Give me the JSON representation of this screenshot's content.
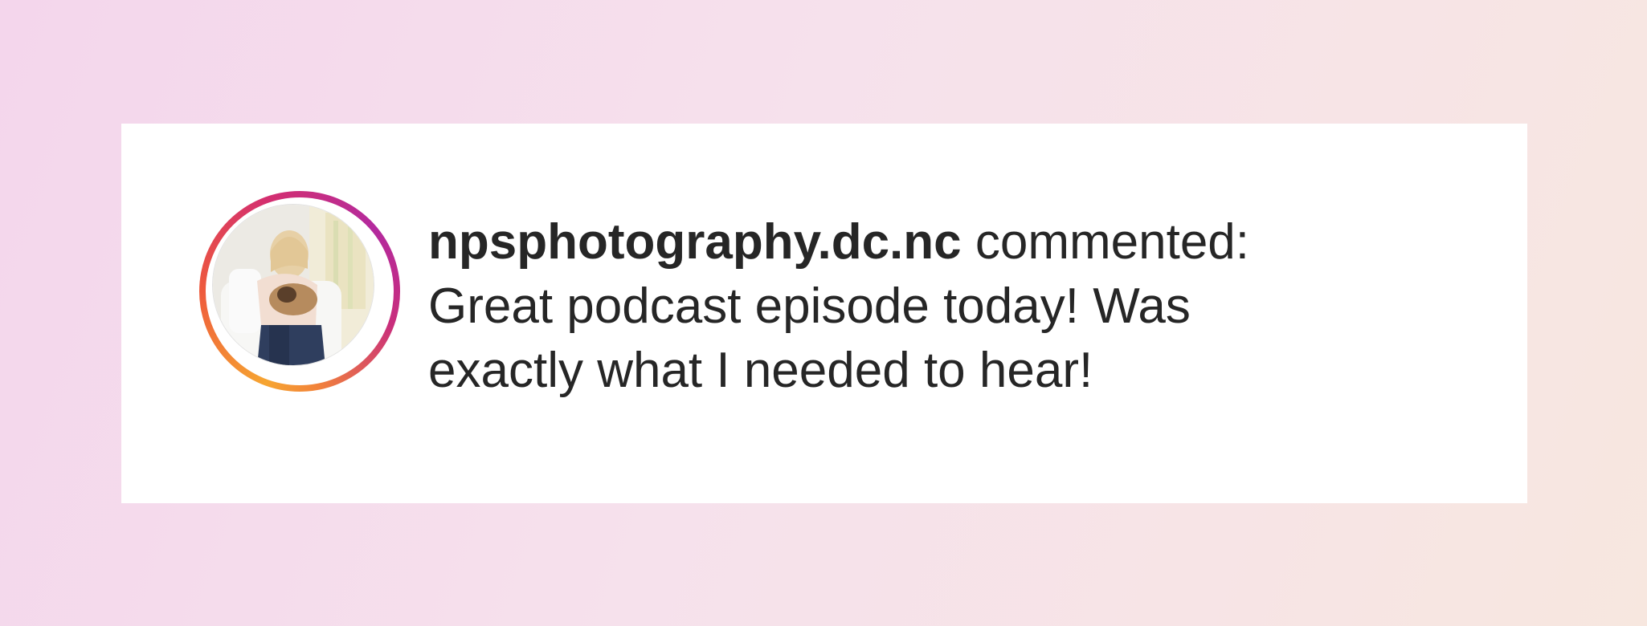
{
  "notification": {
    "username": "npsphotography.dc.nc",
    "action_text": "commented:",
    "comment_line1": "Great podcast episode today! Was",
    "comment_line2": "exactly what I needed to hear!"
  },
  "avatar": {
    "description_icon": "profile-photo",
    "has_story_ring": true
  },
  "colors": {
    "story_ring_start": "#f6a531",
    "story_ring_end": "#b32a9e",
    "text": "#262626",
    "card_background": "#ffffff"
  }
}
